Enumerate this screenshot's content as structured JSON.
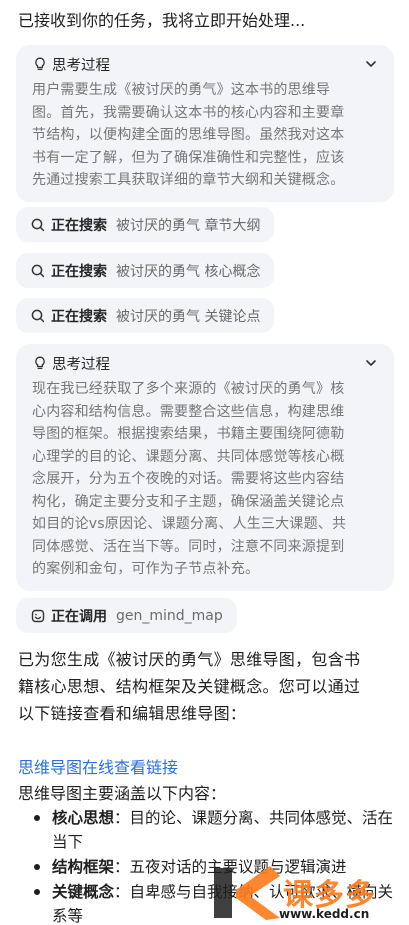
{
  "intro": "已接收到你的任务，我将立即开始处理...",
  "think1": {
    "title": "思考过程",
    "lines": [
      "用户需要生成《被讨厌的勇气》这本书的思维导",
      "图。首先，我需要确认这本书的核心内容和主要章",
      "节结构，以便构建全面的思维导图。虽然我对这本",
      "书有一定了解，但为了确保准确性和完整性，应该",
      "先通过搜索工具获取详细的章节大纲和关键概念。"
    ]
  },
  "searches": [
    {
      "label": "正在搜索",
      "query": "被讨厌的勇气 章节大纲"
    },
    {
      "label": "正在搜索",
      "query": "被讨厌的勇气 核心概念"
    },
    {
      "label": "正在搜索",
      "query": "被讨厌的勇气 关键论点"
    }
  ],
  "think2": {
    "title": "思考过程",
    "lines": [
      "现在我已经获取了多个来源的《被讨厌的勇气》核",
      "心内容和结构信息。需要整合这些信息，构建思维",
      "导图的框架。根据搜索结果，书籍主要围绕阿德勒",
      "心理学的目的论、课题分离、共同体感觉等核心概",
      "念展开，分为五个夜晚的对话。需要将这些内容结",
      "构化，确定主要分支和子主题，确保涵盖关键论点",
      "如目的论vs原因论、课题分离、人生三大课题、共",
      "同体感觉、活在当下等。同时，注意不同来源提到",
      "的案例和金句，可作为子节点补充。"
    ]
  },
  "tool_call": {
    "label": "正在调用",
    "name": "gen_mind_map"
  },
  "answer": {
    "lines": [
      "已为您生成《被讨厌的勇气》思维导图，包含书",
      "籍核心思想、结构框架及关键概念。您可以通过",
      "以下链接查看和编辑思维导图："
    ],
    "link": "思维导图在线查看链接",
    "cover_title": "思维导图主要涵盖以下内容：",
    "bullets": [
      {
        "key": "核心思想",
        "sep": "：",
        "text": "目的论、课题分离、共同体感觉、活在当下"
      },
      {
        "key": "结构框架",
        "sep": "：",
        "text": "五夜对话的主要议题与逻辑演进"
      },
      {
        "key": "关键概念",
        "sep": "：",
        "text": "自卑感与自我接纳、认可欲求、横向关系等"
      }
    ]
  },
  "watermark": {
    "brand": "课多多",
    "url": "www.kedd.cn"
  },
  "colors": {
    "card_bg": "#f2f4f7",
    "link": "#2b6fe0",
    "muted_text": "#767676",
    "watermark": "#ff7a1a"
  }
}
